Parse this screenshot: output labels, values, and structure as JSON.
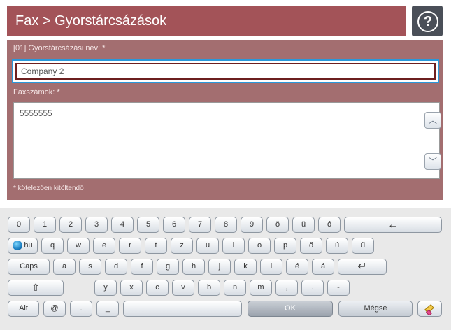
{
  "header": {
    "title": "Fax > Gyorstárcsázások",
    "help_label": "?"
  },
  "form": {
    "name_label": "[01] Gyorstárcsázási név: *",
    "name_value": "Company 2",
    "fax_label": "Faxszámok: *",
    "fax_value": "5555555",
    "required_note": "* kötelezően kitöltendő"
  },
  "keyboard": {
    "row1": [
      "0",
      "1",
      "2",
      "3",
      "4",
      "5",
      "6",
      "7",
      "8",
      "9",
      "ö",
      "ü",
      "ó"
    ],
    "backspace_label": "←",
    "lang_label": "hu",
    "row2": [
      "q",
      "w",
      "e",
      "r",
      "t",
      "z",
      "u",
      "i",
      "o",
      "p",
      "ő",
      "ú",
      "ű"
    ],
    "caps_label": "Caps",
    "row3": [
      "a",
      "s",
      "d",
      "f",
      "g",
      "h",
      "j",
      "k",
      "l",
      "é",
      "á"
    ],
    "enter_label": "↵",
    "shift_label": "⇧",
    "row4": [
      "y",
      "x",
      "c",
      "v",
      "b",
      "n",
      "m",
      ",",
      ".",
      "-"
    ],
    "alt_label": "Alt",
    "at_label": "@",
    "dotcom_label": ".",
    "underscore_label": "_",
    "ok_label": "OK",
    "cancel_label": "Mégse",
    "clear_icon": "eraser-icon"
  }
}
